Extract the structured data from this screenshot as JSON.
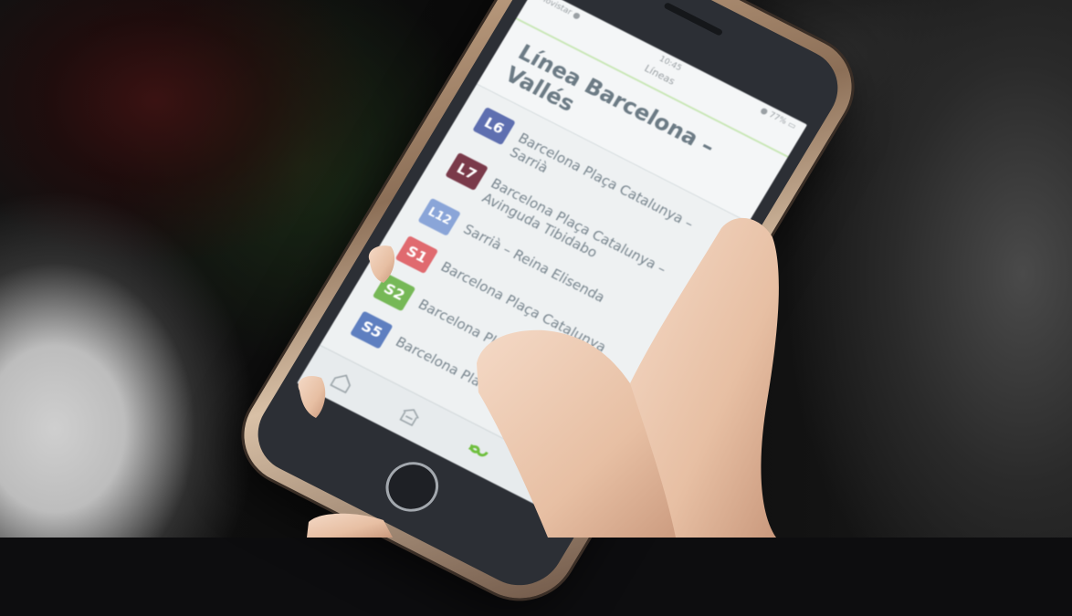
{
  "status_bar": {
    "time": "10:45",
    "signal": "Movistar ●",
    "battery": "● 77% ▭"
  },
  "nav": {
    "title": "Líneas"
  },
  "screen": {
    "title": "Línea Barcelona – Vallés"
  },
  "lines": [
    {
      "code": "L6",
      "name": "Barcelona Plaça Catalunya – Sarrià",
      "color": "#5e6fb0"
    },
    {
      "code": "L7",
      "name": "Barcelona Plaça Catalunya – Avinguda Tibidabo",
      "color": "#7a3a4a"
    },
    {
      "code": "L12",
      "name": "Sarrià – Reina Elisenda",
      "color": "#8aa5d8"
    },
    {
      "code": "S1",
      "name": "Barcelona Plaça Catalunya",
      "color": "#e06a6f"
    },
    {
      "code": "S2",
      "name": "Barcelona Plaça Catalunya",
      "color": "#76b857"
    },
    {
      "code": "S5",
      "name": "Barcelona Plaça",
      "color": "#5e7fc0"
    }
  ],
  "tabs": [
    {
      "icon": "home-icon"
    },
    {
      "icon": "station-icon"
    },
    {
      "icon": "lines-icon",
      "active_color": "#6fbf3e"
    },
    {
      "icon": "alert-icon"
    }
  ]
}
